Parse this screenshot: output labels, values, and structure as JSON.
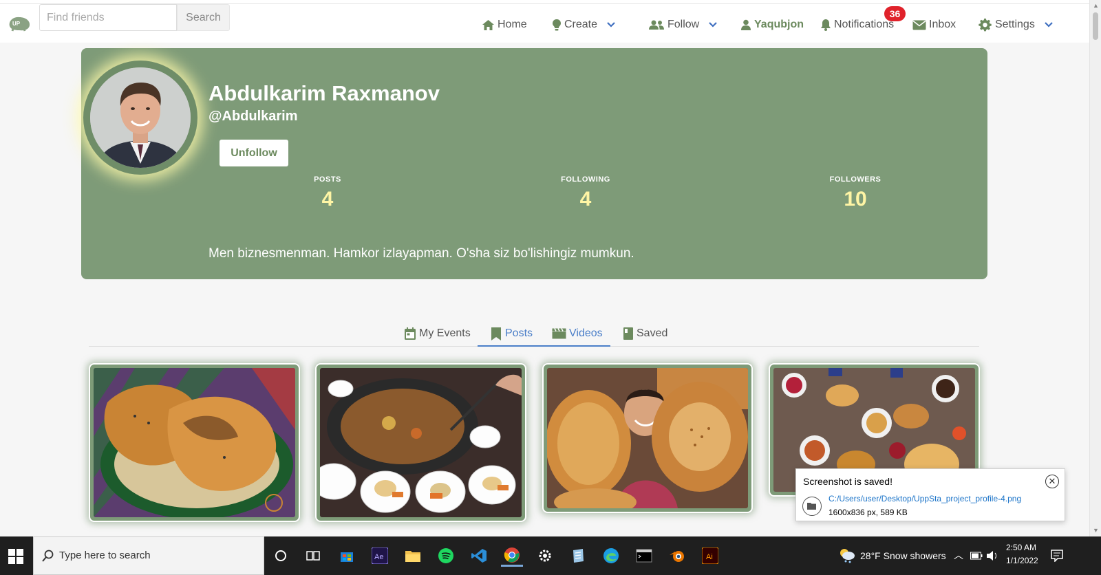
{
  "navbar": {
    "search_placeholder": "Find friends",
    "search_button": "Search",
    "items": {
      "home": "Home",
      "create": "Create",
      "follow": "Follow",
      "user": "Yaqubjon",
      "notifications": "Notifications",
      "inbox": "Inbox",
      "settings": "Settings"
    },
    "notification_count": "36"
  },
  "profile": {
    "name": "Abdulkarim Raxmanov",
    "handle": "@Abdulkarim",
    "unfollow_label": "Unfollow",
    "stats": [
      {
        "label": "POSTS",
        "value": "4"
      },
      {
        "label": "FOLLOWING",
        "value": "4"
      },
      {
        "label": "FOLLOWERS",
        "value": "10"
      }
    ],
    "bio": "Men biznesmenman. Hamkor izlayapman. O'sha siz bo'lishingiz mumkun."
  },
  "tabs": [
    {
      "label": "My Events",
      "icon": "calendar-icon",
      "active": false
    },
    {
      "label": "Posts",
      "icon": "bookmark-icon",
      "active": true
    },
    {
      "label": "Videos",
      "icon": "clapperboard-icon",
      "active": false
    },
    {
      "label": "Saved",
      "icon": "book-icon",
      "active": false
    }
  ],
  "posts": [
    {
      "subject": "samsa pastry"
    },
    {
      "subject": "cauldron soup"
    },
    {
      "subject": "girl with bread"
    },
    {
      "subject": "dastarkhan table"
    }
  ],
  "toast": {
    "title": "Screenshot is saved!",
    "path": "C:/Users/user/Desktop/UppSta_project_profile-4.png",
    "info": "1600x836 px, 589 KB"
  },
  "taskbar": {
    "search_placeholder": "Type here to search",
    "weather": "28°F  Snow showers",
    "time": "2:50 AM",
    "date": "1/1/2022"
  },
  "colors": {
    "brand": "#7e9b78",
    "accent": "#4a7ec8",
    "stat_value": "#fff5a5",
    "badge": "#e0222b"
  }
}
